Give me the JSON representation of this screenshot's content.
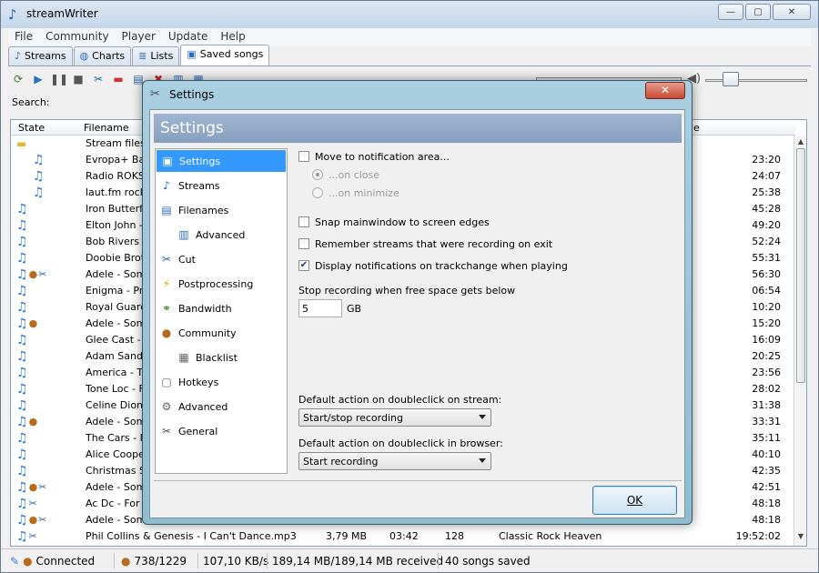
{
  "window": {
    "title": "streamWriter",
    "controls": {
      "minimize": "—",
      "maximize": "▢",
      "close": "✕"
    }
  },
  "menu": [
    "File",
    "Community",
    "Player",
    "Update",
    "Help"
  ],
  "tabs": [
    {
      "label": "Streams",
      "icon": "music-note-icon",
      "active": false
    },
    {
      "label": "Charts",
      "icon": "globe-icon",
      "active": false
    },
    {
      "label": "Lists",
      "icon": "list-icon",
      "active": false
    },
    {
      "label": "Saved songs",
      "icon": "saved-songs-icon",
      "active": true
    }
  ],
  "search": {
    "label": "Search:"
  },
  "list": {
    "columns": [
      "State",
      "Filename",
      "",
      "",
      "",
      "",
      "e"
    ],
    "rows": [
      {
        "state": [
          "folder"
        ],
        "filename": "Stream files",
        "size": "",
        "length": "",
        "bitrate": "",
        "stream": "",
        "time": ""
      },
      {
        "state": [
          "note-sub"
        ],
        "filename": "Evropa+ Baik",
        "size": "",
        "length": "",
        "bitrate": "",
        "stream": "",
        "time": "23:20"
      },
      {
        "state": [
          "note-sub"
        ],
        "filename": "Radio ROKS.r",
        "size": "",
        "length": "",
        "bitrate": "",
        "stream": "",
        "time": "24:07"
      },
      {
        "state": [
          "note-sub"
        ],
        "filename": "laut.fm rock-",
        "size": "",
        "length": "",
        "bitrate": "",
        "stream": "",
        "time": "25:38"
      },
      {
        "state": [
          "note"
        ],
        "filename": "Iron Butterfly",
        "size": "",
        "length": "",
        "bitrate": "",
        "stream": "",
        "time": "45:28"
      },
      {
        "state": [
          "note"
        ],
        "filename": "Elton John - ",
        "size": "",
        "length": "",
        "bitrate": "",
        "stream": "",
        "time": "49:20"
      },
      {
        "state": [
          "note"
        ],
        "filename": "Bob Rivers - ",
        "size": "",
        "length": "",
        "bitrate": "",
        "stream": "",
        "time": "52:24"
      },
      {
        "state": [
          "note"
        ],
        "filename": "Doobie Broth",
        "size": "",
        "length": "",
        "bitrate": "",
        "stream": "",
        "time": "55:31"
      },
      {
        "state": [
          "note",
          "user",
          "scissors"
        ],
        "filename": "Adele - Some",
        "size": "",
        "length": "",
        "bitrate": "",
        "stream": "",
        "time": "56:30"
      },
      {
        "state": [
          "note"
        ],
        "filename": "Enigma - Prin",
        "size": "",
        "length": "",
        "bitrate": "",
        "stream": "",
        "time": "06:54"
      },
      {
        "state": [
          "note"
        ],
        "filename": "Royal Guards",
        "size": "",
        "length": "",
        "bitrate": "",
        "stream": "",
        "time": "10:20"
      },
      {
        "state": [
          "note",
          "user"
        ],
        "filename": "Adele - Some",
        "size": "",
        "length": "",
        "bitrate": "",
        "stream": "",
        "time": "15:20"
      },
      {
        "state": [
          "note"
        ],
        "filename": "Glee Cast - B",
        "size": "",
        "length": "",
        "bitrate": "",
        "stream": "",
        "time": "16:09"
      },
      {
        "state": [
          "note"
        ],
        "filename": "Adam Sandle",
        "size": "",
        "length": "",
        "bitrate": "",
        "stream": "",
        "time": "20:25"
      },
      {
        "state": [
          "note"
        ],
        "filename": "America - Tin",
        "size": "",
        "length": "",
        "bitrate": "",
        "stream": "",
        "time": "23:56"
      },
      {
        "state": [
          "note"
        ],
        "filename": "Tone Loc - Fu",
        "size": "",
        "length": "",
        "bitrate": "",
        "stream": "",
        "time": "28:02"
      },
      {
        "state": [
          "note"
        ],
        "filename": "Celine Dion - ",
        "size": "",
        "length": "",
        "bitrate": "",
        "stream": "",
        "time": "31:38"
      },
      {
        "state": [
          "note",
          "user"
        ],
        "filename": "Adele - Some",
        "size": "",
        "length": "",
        "bitrate": "",
        "stream": "",
        "time": "33:31"
      },
      {
        "state": [
          "note"
        ],
        "filename": "The Cars - M",
        "size": "",
        "length": "",
        "bitrate": "",
        "stream": "",
        "time": "35:11"
      },
      {
        "state": [
          "note"
        ],
        "filename": "Alice Cooper",
        "size": "",
        "length": "",
        "bitrate": "",
        "stream": "",
        "time": "40:10"
      },
      {
        "state": [
          "note"
        ],
        "filename": "Christmas So",
        "size": "",
        "length": "",
        "bitrate": "",
        "stream": "",
        "time": "42:35"
      },
      {
        "state": [
          "note",
          "user",
          "scissors"
        ],
        "filename": "Adele - Some",
        "size": "",
        "length": "",
        "bitrate": "",
        "stream": "",
        "time": "42:51"
      },
      {
        "state": [
          "note",
          "scissors"
        ],
        "filename": "Ac Dc - For T",
        "size": "",
        "length": "",
        "bitrate": "",
        "stream": "",
        "time": "48:18"
      },
      {
        "state": [
          "note",
          "user",
          "scissors"
        ],
        "filename": "Adele - Some",
        "size": "",
        "length": "",
        "bitrate": "",
        "stream": "",
        "time": "48:18"
      },
      {
        "state": [
          "note",
          "scissors"
        ],
        "filename": "Phil Collins & Genesis - I Can't Dance.mp3",
        "size": "3,79 MB",
        "length": "03:42",
        "bitrate": "128",
        "stream": "Classic Rock Heaven",
        "time": "19:52:02"
      }
    ]
  },
  "status": {
    "connection": "Connected",
    "clients": "738/1229",
    "speed": "107,10 KB/s",
    "received": "189,14 MB/189,14 MB received",
    "saved": "40 songs saved"
  },
  "dialog": {
    "title": "Settings",
    "header": "Settings",
    "close": "✕",
    "nav": [
      {
        "label": "Settings",
        "icon": "settings-icon",
        "selected": true,
        "sub": false
      },
      {
        "label": "Streams",
        "icon": "music-note-icon",
        "selected": false,
        "sub": false
      },
      {
        "label": "Filenames",
        "icon": "filenames-icon",
        "selected": false,
        "sub": false
      },
      {
        "label": "Advanced",
        "icon": "advanced-filenames-icon",
        "selected": false,
        "sub": true
      },
      {
        "label": "Cut",
        "icon": "scissors-icon",
        "selected": false,
        "sub": false
      },
      {
        "label": "Postprocessing",
        "icon": "lightning-icon",
        "selected": false,
        "sub": false
      },
      {
        "label": "Bandwidth",
        "icon": "bandwidth-icon",
        "selected": false,
        "sub": false
      },
      {
        "label": "Community",
        "icon": "community-icon",
        "selected": false,
        "sub": false
      },
      {
        "label": "Blacklist",
        "icon": "blacklist-icon",
        "selected": false,
        "sub": true
      },
      {
        "label": "Hotkeys",
        "icon": "hotkeys-icon",
        "selected": false,
        "sub": false
      },
      {
        "label": "Advanced",
        "icon": "gear-icon",
        "selected": false,
        "sub": false
      },
      {
        "label": "General",
        "icon": "tools-icon",
        "selected": false,
        "sub": false
      }
    ],
    "options": {
      "move_to_tray": {
        "label": "Move to notification area...",
        "checked": false
      },
      "on_close": {
        "label": "...on close",
        "selected": true,
        "disabled": true
      },
      "on_minimize": {
        "label": "...on minimize",
        "selected": false,
        "disabled": true
      },
      "snap": {
        "label": "Snap mainwindow to screen edges",
        "checked": false
      },
      "remember": {
        "label": "Remember streams that were recording on exit",
        "checked": false
      },
      "notifications": {
        "label": "Display notifications on trackchange when playing",
        "checked": true
      },
      "free_space_label": "Stop recording when free space gets below",
      "free_space_value": "5",
      "free_space_unit": "GB",
      "dbl_stream_label": "Default action on doubleclick on stream:",
      "dbl_stream_value": "Start/stop recording",
      "dbl_browser_label": "Default action on doubleclick in browser:",
      "dbl_browser_value": "Start recording"
    },
    "ok_label": "OK"
  }
}
